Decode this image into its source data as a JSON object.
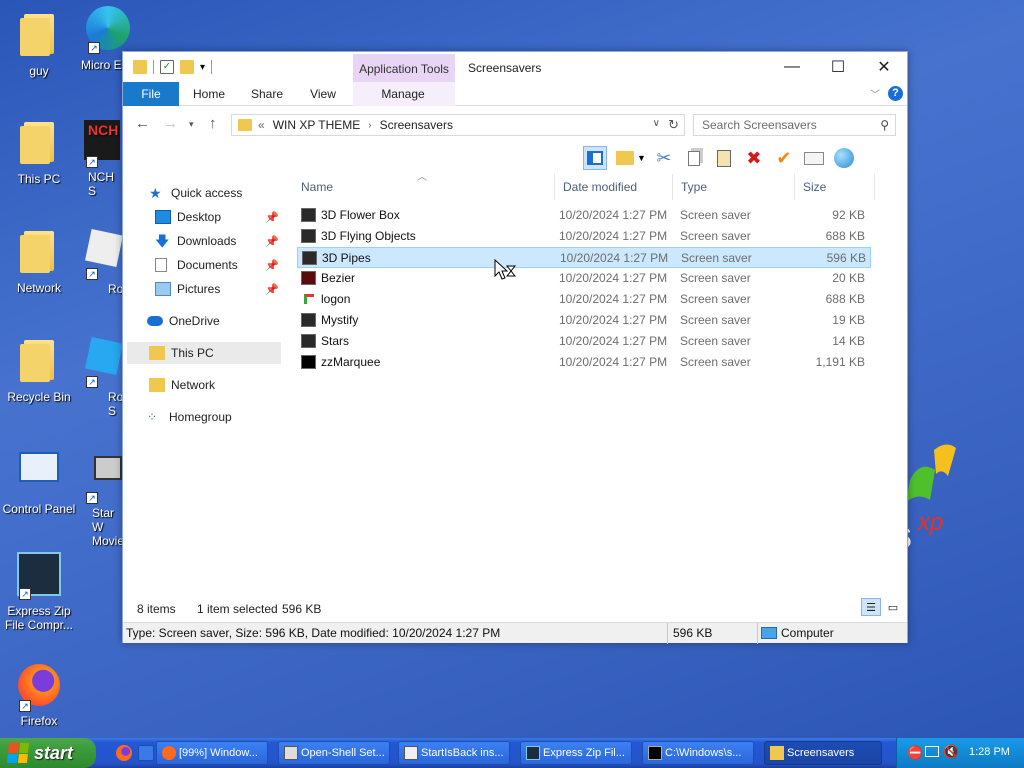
{
  "desktop": {
    "icons": [
      {
        "label": "guy"
      },
      {
        "label": "Micro Edg"
      },
      {
        "label": "This PC"
      },
      {
        "label": "NCH S"
      },
      {
        "label": "Network"
      },
      {
        "label": "Roblox"
      },
      {
        "label": "Recycle Bin"
      },
      {
        "label": "Roblox S"
      },
      {
        "label": "Control Panel"
      },
      {
        "label": "Star W Movie"
      },
      {
        "label": "Express Zip File Compr..."
      },
      {
        "label": "Firefox"
      }
    ],
    "xp_watermark": "xp"
  },
  "window": {
    "app_tools_label": "Application Tools",
    "title": "Screensavers",
    "caption": {
      "minimize": "—",
      "maximize": "☐",
      "close": "✕"
    },
    "ribbon_tabs": [
      "File",
      "Home",
      "Share",
      "View",
      "Manage"
    ],
    "address": {
      "prefix": "«",
      "segments": [
        "WIN XP THEME",
        "Screensavers"
      ]
    },
    "search_placeholder": "Search Screensavers",
    "nav_pane": [
      {
        "label": "Quick access"
      },
      {
        "label": "Desktop"
      },
      {
        "label": "Downloads"
      },
      {
        "label": "Documents"
      },
      {
        "label": "Pictures"
      },
      {
        "label": "OneDrive"
      },
      {
        "label": "This PC"
      },
      {
        "label": "Network"
      },
      {
        "label": "Homegroup"
      }
    ],
    "columns": [
      "Name",
      "Date modified",
      "Type",
      "Size"
    ],
    "files": [
      {
        "name": "3D Flower Box",
        "date": "10/20/2024 1:27 PM",
        "type": "Screen saver",
        "size": "92 KB"
      },
      {
        "name": "3D Flying Objects",
        "date": "10/20/2024 1:27 PM",
        "type": "Screen saver",
        "size": "688 KB"
      },
      {
        "name": "3D Pipes",
        "date": "10/20/2024 1:27 PM",
        "type": "Screen saver",
        "size": "596 KB"
      },
      {
        "name": "Bezier",
        "date": "10/20/2024 1:27 PM",
        "type": "Screen saver",
        "size": "20 KB"
      },
      {
        "name": "logon",
        "date": "10/20/2024 1:27 PM",
        "type": "Screen saver",
        "size": "688 KB"
      },
      {
        "name": "Mystify",
        "date": "10/20/2024 1:27 PM",
        "type": "Screen saver",
        "size": "19 KB"
      },
      {
        "name": "Stars",
        "date": "10/20/2024 1:27 PM",
        "type": "Screen saver",
        "size": "14 KB"
      },
      {
        "name": "zzMarquee",
        "date": "10/20/2024 1:27 PM",
        "type": "Screen saver",
        "size": "1,191 KB"
      }
    ],
    "selected_index": 2,
    "status": {
      "item_count": "8 items",
      "selection": "1 item selected",
      "selection_size": "596 KB"
    },
    "details": {
      "info": "Type: Screen saver, Size: 596 KB, Date modified: 10/20/2024 1:27 PM",
      "size": "596 KB",
      "location": "Computer"
    }
  },
  "taskbar": {
    "start_label": "start",
    "tasks": [
      {
        "label": "[99%] Window..."
      },
      {
        "label": "Open-Shell Set..."
      },
      {
        "label": "StartIsBack ins..."
      },
      {
        "label": "Express Zip Fil..."
      },
      {
        "label": "C:\\Windows\\s..."
      },
      {
        "label": "Screensavers"
      }
    ],
    "clock": "1:28 PM"
  },
  "colors": {
    "accent": "#1979ca",
    "selection": "#cce8ff",
    "taskbar": "#2458d4",
    "start": "#3a9b3a"
  }
}
